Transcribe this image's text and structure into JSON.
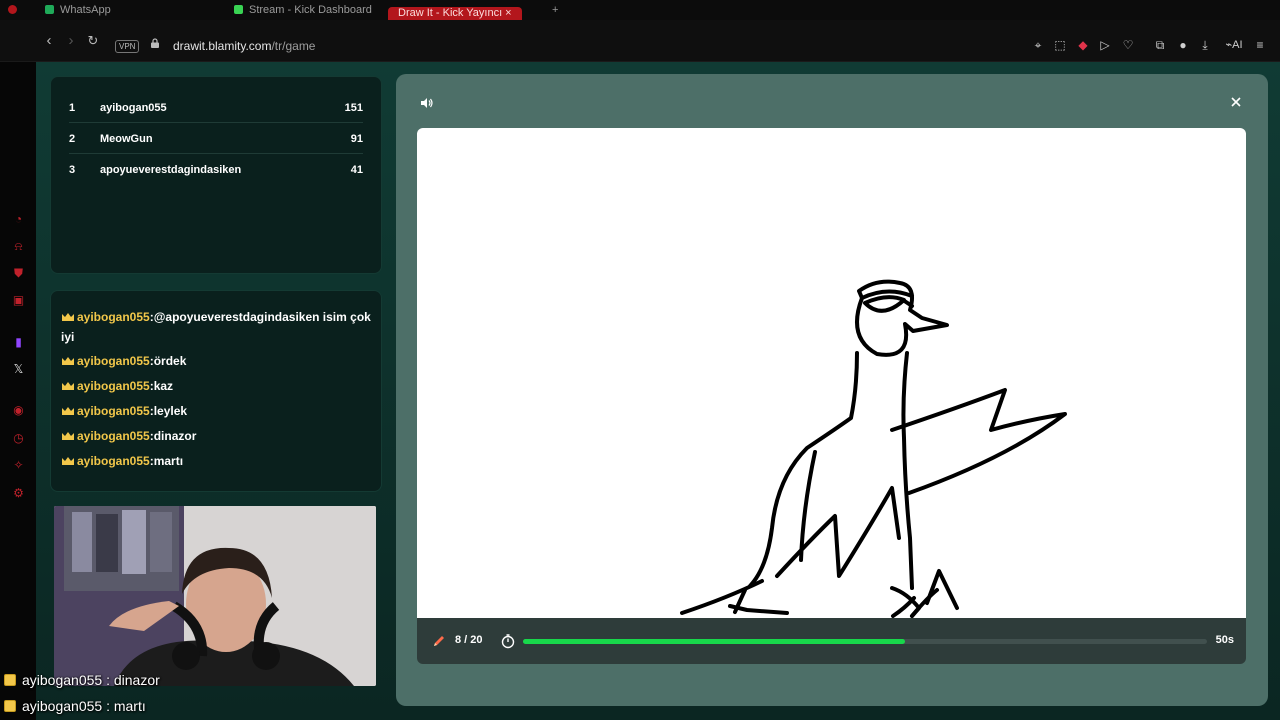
{
  "browser": {
    "tabs": [
      {
        "label": "WhatsApp"
      },
      {
        "label": "Stream - Kick Dashboard"
      },
      {
        "label": "Draw It - Kick Yayıncı"
      }
    ],
    "url_host": "drawit.blamity.com",
    "url_path": "/tr/game",
    "vpn_label": "VPN",
    "ai_label": "AI"
  },
  "leaderboard": [
    {
      "rank": "1",
      "name": "ayibogan055",
      "score": "151"
    },
    {
      "rank": "2",
      "name": "MeowGun",
      "score": "91"
    },
    {
      "rank": "3",
      "name": "apoyueverestdagindasiken",
      "score": "41"
    }
  ],
  "chat": [
    {
      "user": "ayibogan055",
      "text": ":@apoyueverestdagindasiken isim çok iyi"
    },
    {
      "user": "ayibogan055",
      "text": ":ördek"
    },
    {
      "user": "ayibogan055",
      "text": ":kaz"
    },
    {
      "user": "ayibogan055",
      "text": ":leylek"
    },
    {
      "user": "ayibogan055",
      "text": ":dinazor"
    },
    {
      "user": "ayibogan055",
      "text": ":martı"
    }
  ],
  "overlay_chat": [
    {
      "text": "ayibogan055 : dinazor"
    },
    {
      "text": "ayibogan055 : martı"
    }
  ],
  "game": {
    "round": "8 / 20",
    "time_left": "50s",
    "progress_fraction": 0.558
  },
  "colors": {
    "accent_green": "#18d84b",
    "username_gold": "#f2c74a",
    "brand_red": "#c0212b"
  },
  "icons": [
    "volume-icon",
    "close-icon",
    "pencil-icon",
    "timer-icon",
    "crown-icon"
  ]
}
